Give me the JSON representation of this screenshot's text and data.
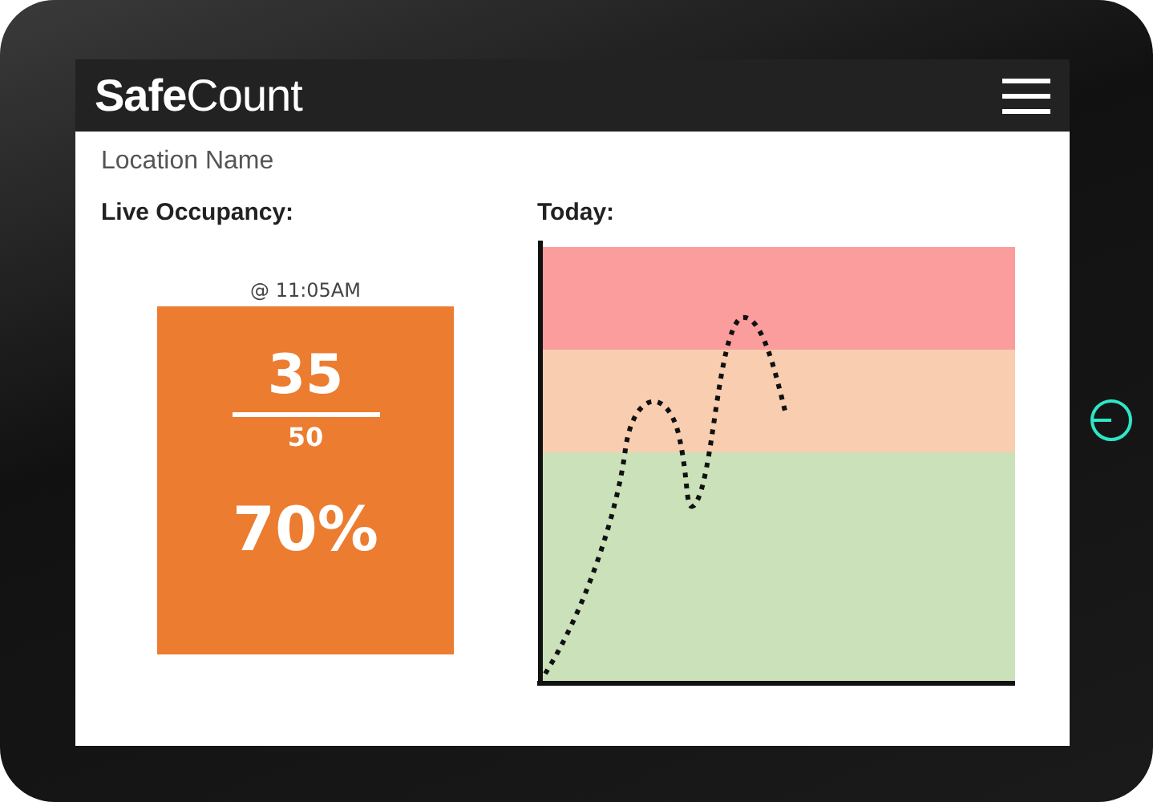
{
  "app": {
    "title": "**Safe**Count"
  },
  "location": "Location Name",
  "occupancy": {
    "heading": "Live Occupancy:",
    "time": "@ 11:05AM",
    "count": "35",
    "capacity": "50",
    "percent": "70%"
  },
  "today": {
    "heading": "Today:"
  }
}
